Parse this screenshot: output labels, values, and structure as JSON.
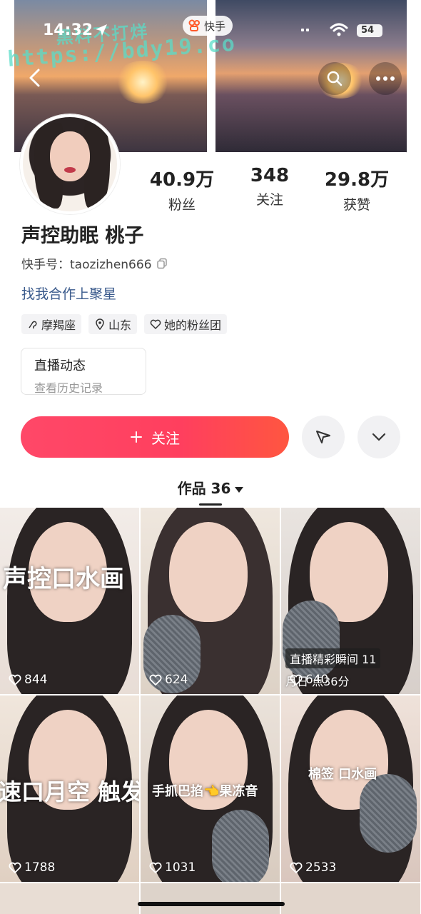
{
  "status_bar": {
    "time": "14:32",
    "app_pill": "快手",
    "battery": "54"
  },
  "watermark": {
    "line1": "黑料不打烊",
    "line2": "https://bdy19.co"
  },
  "profile": {
    "name": "声控助眠 桃子",
    "uid_label": "快手号：taozizhen666",
    "bio_link": "找我合作上聚星",
    "stats": [
      {
        "num": "40.9万",
        "label": "粉丝"
      },
      {
        "num": "348",
        "label": "关注"
      },
      {
        "num": "29.8万",
        "label": "获赞"
      }
    ],
    "tags": [
      {
        "icon": "capricorn-icon",
        "label": "摩羯座"
      },
      {
        "icon": "location-pin-icon",
        "label": "山东"
      },
      {
        "icon": "heart-outline-icon",
        "label": "她的粉丝团"
      }
    ]
  },
  "live_card": {
    "title": "直播动态",
    "subtitle": "查看历史记录"
  },
  "actions": {
    "follow_label": "关注"
  },
  "works_tab": {
    "label": "作品 36"
  },
  "videos": [
    {
      "likes": "844",
      "caption": "声控口水画",
      "badge": "",
      "badge_time": ""
    },
    {
      "likes": "624",
      "caption": "",
      "badge": "",
      "badge_time": ""
    },
    {
      "likes": "640",
      "caption": "",
      "badge": "直播精彩瞬间 11",
      "badge_time": "月日 点36分"
    },
    {
      "likes": "1788",
      "caption": "速口月空 触发",
      "badge": "",
      "badge_time": ""
    },
    {
      "likes": "1031",
      "caption": "手抓巴掐👈果冻音",
      "badge": "",
      "badge_time": ""
    },
    {
      "likes": "2533",
      "caption": "棉签 口水画",
      "badge": "",
      "badge_time": ""
    }
  ],
  "colors": {
    "accent": "#ff4868",
    "link": "#3a5a8c"
  }
}
